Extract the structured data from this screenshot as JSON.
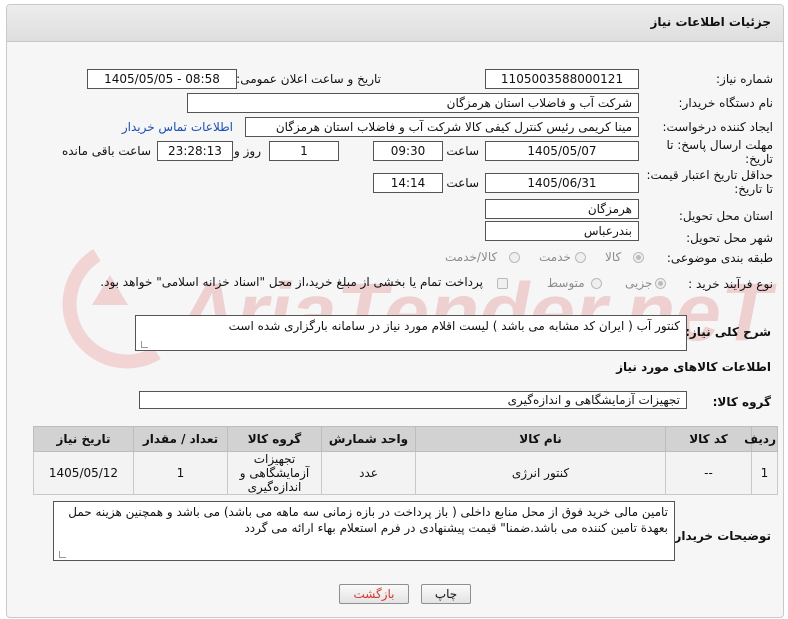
{
  "header": {
    "title": "جزئیات اطلاعات نیاز"
  },
  "watermark": {
    "text": "AriaTender.neT"
  },
  "form": {
    "need_number_label": "شماره نیاز:",
    "need_number": "1105003588000121",
    "announce_label": "تاریخ و ساعت اعلان عمومی:",
    "announce_value": "1405/05/05 - 08:58",
    "buyer_org_label": "نام دستگاه خریدار:",
    "buyer_org": "شرکت آب و فاضلاب استان هرمزگان",
    "requester_label": "ایجاد کننده درخواست:",
    "requester": "مینا کریمی رئیس کنترل کیفی کالا شرکت آب و فاضلاب استان هرمزگان",
    "contact_link": "اطلاعات تماس خریدار",
    "deadline_label": "مهلت ارسال پاسخ: تا تاریخ:",
    "deadline_date": "1405/05/07",
    "time_label": "ساعت",
    "deadline_time": "09:30",
    "days_value": "1",
    "days_label": "روز و",
    "remaining_time": "23:28:13",
    "remaining_label": "ساعت باقی مانده",
    "validity_label": "حداقل تاریخ اعتبار قیمت: تا تاریخ:",
    "validity_date": "1405/06/31",
    "validity_time": "14:14",
    "province_label": "استان محل تحویل:",
    "province": "هرمزگان",
    "city_label": "شهر محل تحویل:",
    "city": "بندرعباس",
    "category_label": "طبقه بندی موضوعی:",
    "category_options": [
      "کالا",
      "خدمت",
      "کالا/خدمت"
    ],
    "process_label": "نوع فرآیند خرید :",
    "process_options": [
      "جزیی",
      "متوسط"
    ],
    "payment_note": "پرداخت تمام یا بخشی از مبلغ خرید،از محل \"اسناد خزانه اسلامی\" خواهد بود."
  },
  "description": {
    "label": "شرح کلی نیاز:",
    "text": "کنتور آب ( ایران کد مشابه می باشد ) لیست اقلام مورد نیاز در سامانه بارگزاری شده است"
  },
  "goods": {
    "section_title": "اطلاعات کالاهای مورد نیاز",
    "group_label": "گروه کالا:",
    "group_value": "تجهیزات آزمایشگاهی و اندازه‌گیری"
  },
  "table": {
    "headers": [
      "ردیف",
      "کد کالا",
      "نام کالا",
      "واحد شمارش",
      "گروه کالا",
      "تعداد / مقدار",
      "تاریخ نیاز"
    ],
    "rows": [
      {
        "row": "1",
        "code": "--",
        "name": "کنتور انرژی",
        "unit": "عدد",
        "group": "تجهیزات آزمایشگاهی و اندازه‌گیری",
        "qty": "1",
        "date": "1405/05/12"
      }
    ]
  },
  "buyer_notes": {
    "label": "توضیحات خریدار:",
    "text": "تامین مالی خرید فوق از محل منابع داخلی ( باز پرداخت در بازه زمانی سه ماهه می باشد) می باشد و همچنین هزینه حمل بعهدة تامین کننده می باشد.ضمنا\" قیمت پیشنهادی  در فرم استعلام بهاء  ارائه می گردد"
  },
  "buttons": {
    "print": "چاپ",
    "back": "بازگشت"
  }
}
